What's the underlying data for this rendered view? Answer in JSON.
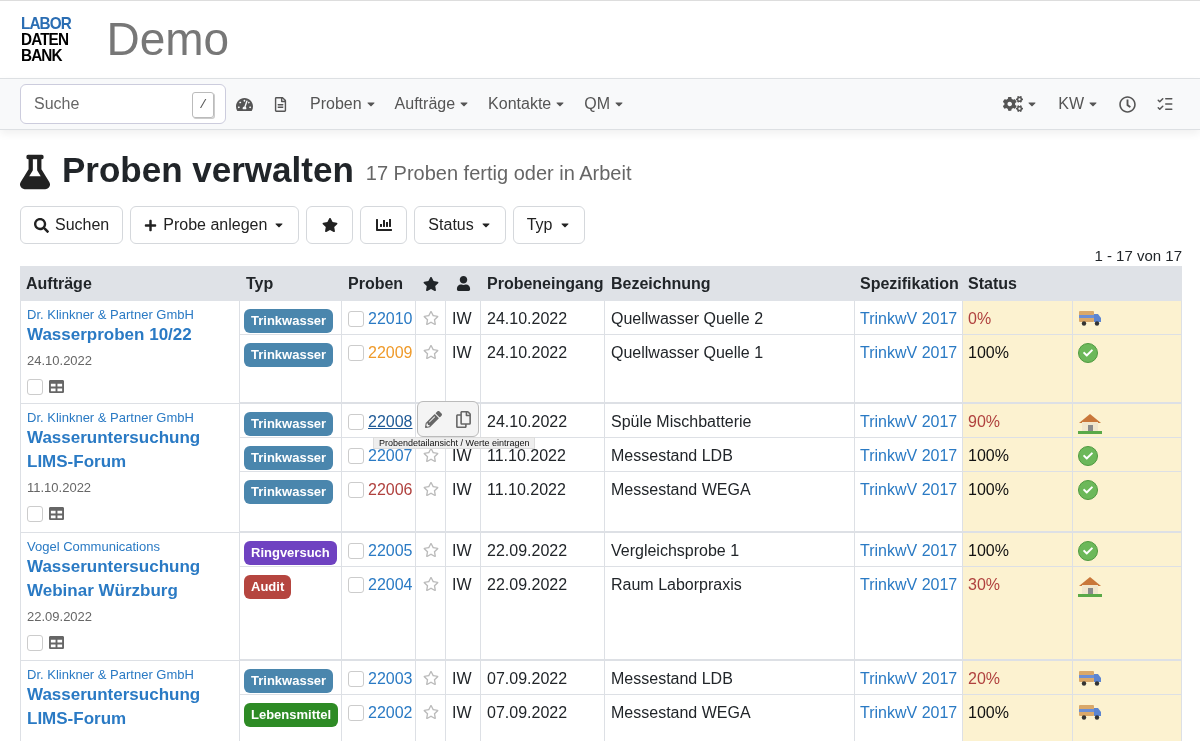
{
  "logo": {
    "lines": [
      "LABOR",
      "DATEN",
      "BANK"
    ]
  },
  "app_title": "Demo",
  "navbar": {
    "search": {
      "placeholder": "Suche",
      "shortcut": "/"
    },
    "menus": [
      {
        "label": "Proben"
      },
      {
        "label": "Aufträge"
      },
      {
        "label": "Kontakte"
      },
      {
        "label": "QM"
      }
    ],
    "user": "KW"
  },
  "page": {
    "title": "Proben verwalten",
    "subtitle": "17 Proben fertig oder in Arbeit"
  },
  "toolbar": {
    "search_button": "Suchen",
    "new_button": "Probe anlegen",
    "status_menu": "Status",
    "type_menu": "Typ"
  },
  "pagination": "1 - 17 von 17",
  "hover_tooltip": "Probendetailansicht / Werte eintragen",
  "table": {
    "columns": [
      "Aufträge",
      "Typ",
      "Proben",
      "Probeneingang",
      "Bezeichnung",
      "Spezifikation",
      "Status"
    ],
    "groups": [
      {
        "company": "Dr. Klinkner & Partner GmbH",
        "title": "Wasserproben 10/22",
        "date": "24.10.2022",
        "checked": false,
        "samples": [
          {
            "kind": "shipping",
            "type": {
              "label": "Trinkwasser",
              "color": "#4a86ad"
            },
            "checked": false,
            "number": {
              "text": "22010",
              "color": "#2a7ac4"
            },
            "hovered": false,
            "starred": false,
            "person": "IW",
            "received": "24.10.2022",
            "name": "Quellwasser Quelle 2",
            "spec": "TrinkwV 2017",
            "status": {
              "text": "0%",
              "complete": false
            }
          },
          {
            "kind": "done",
            "type": {
              "label": "Trinkwasser",
              "color": "#4a86ad"
            },
            "checked": false,
            "number": {
              "text": "22009",
              "color": "#ef9a2a"
            },
            "hovered": false,
            "starred": false,
            "person": "IW",
            "received": "24.10.2022",
            "name": "Quellwasser Quelle 1",
            "spec": "TrinkwV 2017",
            "status": {
              "text": "100%",
              "complete": true
            }
          }
        ]
      },
      {
        "company": "Dr. Klinkner & Partner GmbH",
        "title": "Wasseruntersuchung LIMS-Forum",
        "date": "11.10.2022",
        "checked": false,
        "samples": [
          {
            "kind": "onsite",
            "type": {
              "label": "Trinkwasser",
              "color": "#4a86ad"
            },
            "checked": false,
            "number": {
              "text": "22008",
              "color": "#1f5a96"
            },
            "hovered": true,
            "received": "24.10.2022",
            "name": "Spüle Mischbatterie",
            "spec": "TrinkwV 2017",
            "status": {
              "text": "90%",
              "complete": false
            }
          },
          {
            "kind": "done",
            "type": {
              "label": "Trinkwasser",
              "color": "#4a86ad"
            },
            "checked": false,
            "number": {
              "text": "22007",
              "color": "#2a7ac4"
            },
            "hovered": false,
            "starred": false,
            "person": "IW",
            "received": "11.10.2022",
            "name": "Messestand LDB",
            "spec": "TrinkwV 2017",
            "status": {
              "text": "100%",
              "complete": true
            }
          },
          {
            "kind": "done",
            "type": {
              "label": "Trinkwasser",
              "color": "#4a86ad"
            },
            "checked": false,
            "number": {
              "text": "22006",
              "color": "#b0413e"
            },
            "hovered": false,
            "starred": false,
            "person": "IW",
            "received": "11.10.2022",
            "name": "Messestand WEGA",
            "spec": "TrinkwV 2017",
            "status": {
              "text": "100%",
              "complete": true
            }
          }
        ]
      },
      {
        "company": "Vogel Communications",
        "title": "Wasseruntersuchung Webinar Würzburg",
        "date": "22.09.2022",
        "checked": false,
        "samples": [
          {
            "kind": "done",
            "type": {
              "label": "Ringversuch",
              "color": "#6f42c1"
            },
            "checked": false,
            "number": {
              "text": "22005",
              "color": "#2a7ac4"
            },
            "hovered": false,
            "starred": false,
            "person": "IW",
            "received": "22.09.2022",
            "name": "Vergleichsprobe 1",
            "spec": "TrinkwV 2017",
            "status": {
              "text": "100%",
              "complete": true
            }
          },
          {
            "kind": "onsite",
            "type": {
              "label": "Audit",
              "color": "#b5453f"
            },
            "checked": false,
            "number": {
              "text": "22004",
              "color": "#2a7ac4"
            },
            "hovered": false,
            "starred": false,
            "person": "IW",
            "received": "22.09.2022",
            "name": "Raum Laborpraxis",
            "spec": "TrinkwV 2017",
            "status": {
              "text": "30%",
              "complete": false
            }
          }
        ]
      },
      {
        "company": "Dr. Klinkner & Partner GmbH",
        "title": "Wasseruntersuchung LIMS-Forum",
        "samples": [
          {
            "kind": "shipping",
            "type": {
              "label": "Trinkwasser",
              "color": "#4a86ad"
            },
            "checked": false,
            "number": {
              "text": "22003",
              "color": "#2a7ac4"
            },
            "hovered": false,
            "starred": false,
            "person": "IW",
            "received": "07.09.2022",
            "name": "Messestand LDB",
            "spec": "TrinkwV 2017",
            "status": {
              "text": "20%",
              "complete": false
            }
          },
          {
            "kind": "shipping",
            "type": {
              "label": "Lebensmittel",
              "color": "#2e8b25"
            },
            "checked": false,
            "number": {
              "text": "22002",
              "color": "#2a7ac4"
            },
            "hovered": false,
            "starred": false,
            "person": "IW",
            "received": "07.09.2022",
            "name": "Messestand WEGA",
            "spec": "TrinkwV 2017",
            "status": {
              "text": "100%",
              "complete": true
            }
          }
        ]
      }
    ]
  }
}
